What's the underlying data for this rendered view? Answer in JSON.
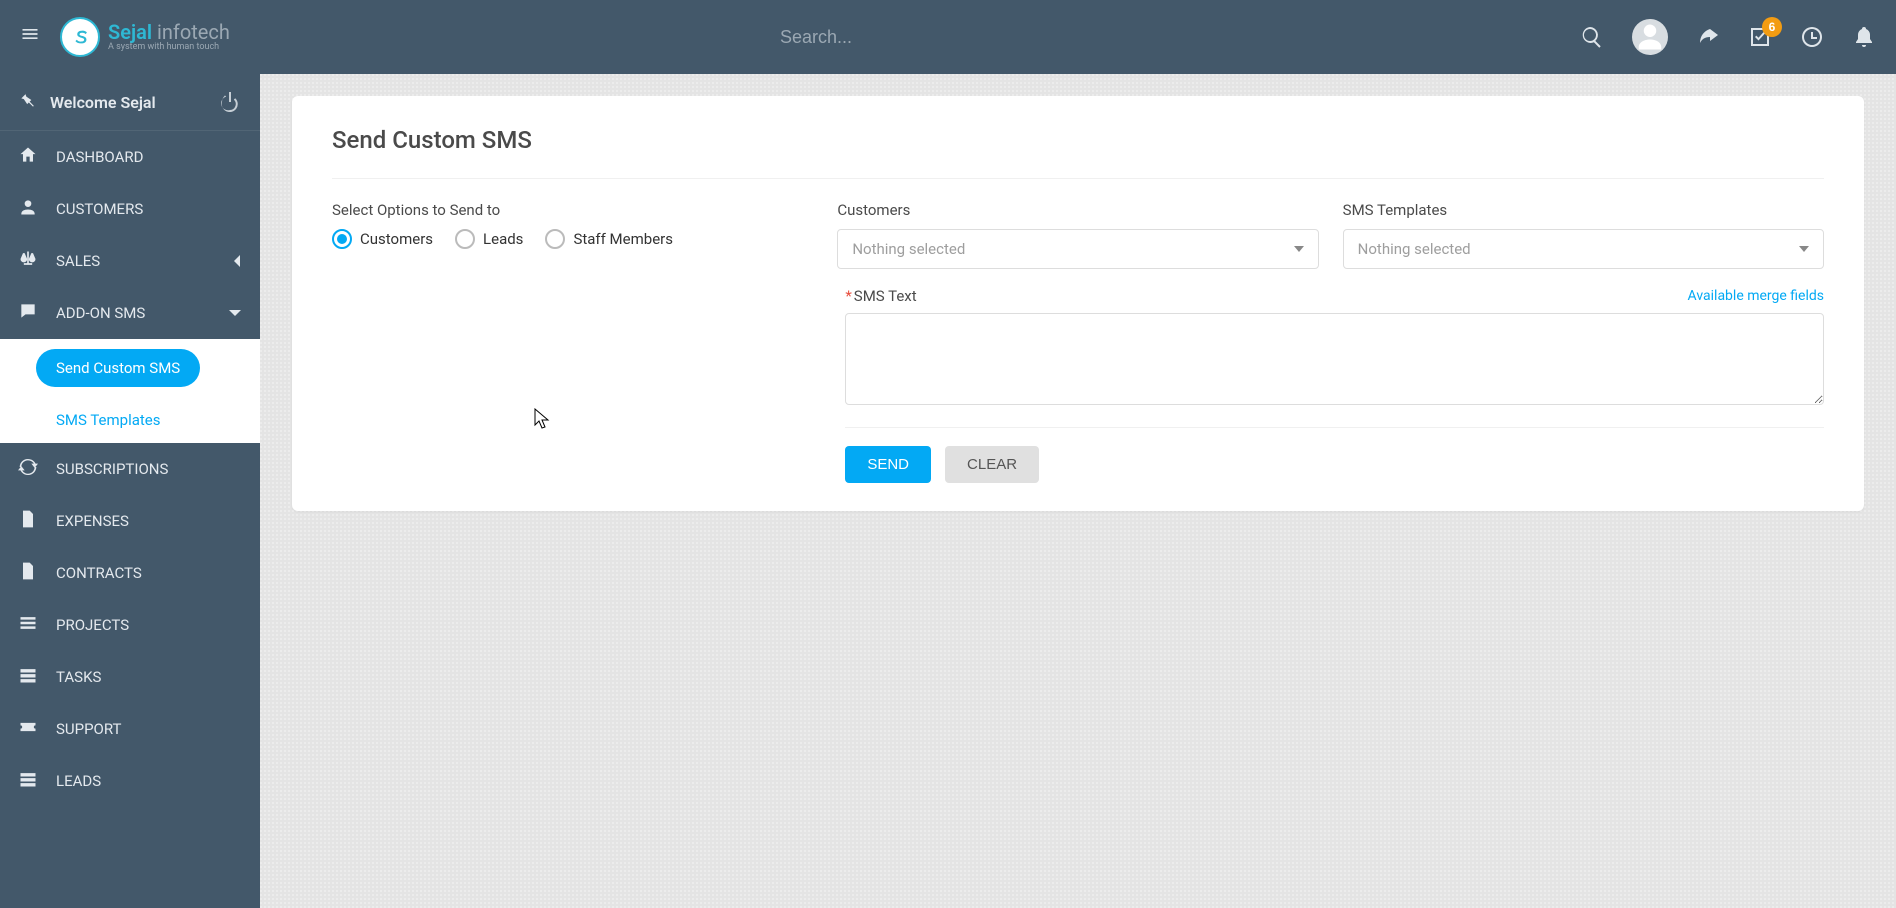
{
  "brand": {
    "name": "Sejal",
    "suffix": "infotech",
    "tagline": "A system with human touch"
  },
  "topbar": {
    "search_placeholder": "Search...",
    "badge_count": "6"
  },
  "welcome": {
    "text": "Welcome Sejal"
  },
  "sidebar": [
    {
      "label": "DASHBOARD",
      "icon": "home"
    },
    {
      "label": "CUSTOMERS",
      "icon": "user"
    },
    {
      "label": "SALES",
      "icon": "scales",
      "chev": true
    },
    {
      "label": "ADD-ON SMS",
      "icon": "chat",
      "chev_open": true,
      "submenu": [
        {
          "label": "Send Custom SMS",
          "active": true
        },
        {
          "label": "SMS Templates",
          "link": true
        }
      ]
    },
    {
      "label": "SUBSCRIPTIONS",
      "icon": "refresh"
    },
    {
      "label": "EXPENSES",
      "icon": "doc"
    },
    {
      "label": "CONTRACTS",
      "icon": "file"
    },
    {
      "label": "PROJECTS",
      "icon": "bars"
    },
    {
      "label": "TASKS",
      "icon": "rows"
    },
    {
      "label": "SUPPORT",
      "icon": "ticket"
    },
    {
      "label": "LEADS",
      "icon": "rows"
    }
  ],
  "page": {
    "title": "Send Custom SMS",
    "select_label": "Select Options to Send to",
    "radios": [
      {
        "label": "Customers",
        "checked": true
      },
      {
        "label": "Leads",
        "checked": false
      },
      {
        "label": "Staff Members",
        "checked": false
      }
    ],
    "customers_label": "Customers",
    "customers_value": "Nothing selected",
    "templates_label": "SMS Templates",
    "templates_value": "Nothing selected",
    "sms_text_label": "SMS Text",
    "merge_link": "Available merge fields",
    "send_label": "SEND",
    "clear_label": "CLEAR"
  }
}
